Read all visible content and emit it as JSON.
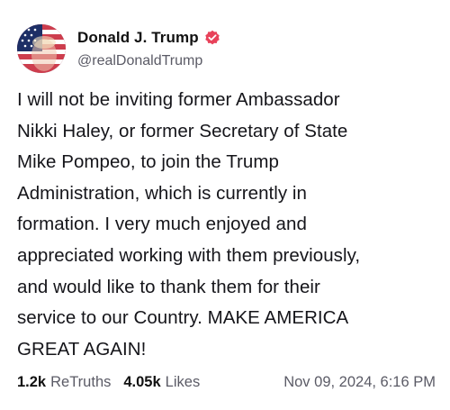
{
  "post": {
    "author": {
      "display_name": "Donald J. Trump",
      "handle": "@realDonaldTrump",
      "verified_badge_color": "#e8425a"
    },
    "body": "I will not be inviting former Ambassador\nNikki Haley, or former Secretary of State\nMike Pompeo, to join the Trump\nAdministration, which is currently in\nformation. I very much enjoyed and\nappreciated working with them previously,\nand would like to thank them for their\nservice to our Country. MAKE AMERICA\nGREAT AGAIN!",
    "stats": {
      "retruths_count": "1.2k",
      "retruths_label": "ReTruths",
      "likes_count": "4.05k",
      "likes_label": "Likes"
    },
    "timestamp": "Nov 09, 2024, 6:16 PM"
  },
  "icons": {
    "verified": "verified-check-icon",
    "avatar": "profile-avatar"
  }
}
